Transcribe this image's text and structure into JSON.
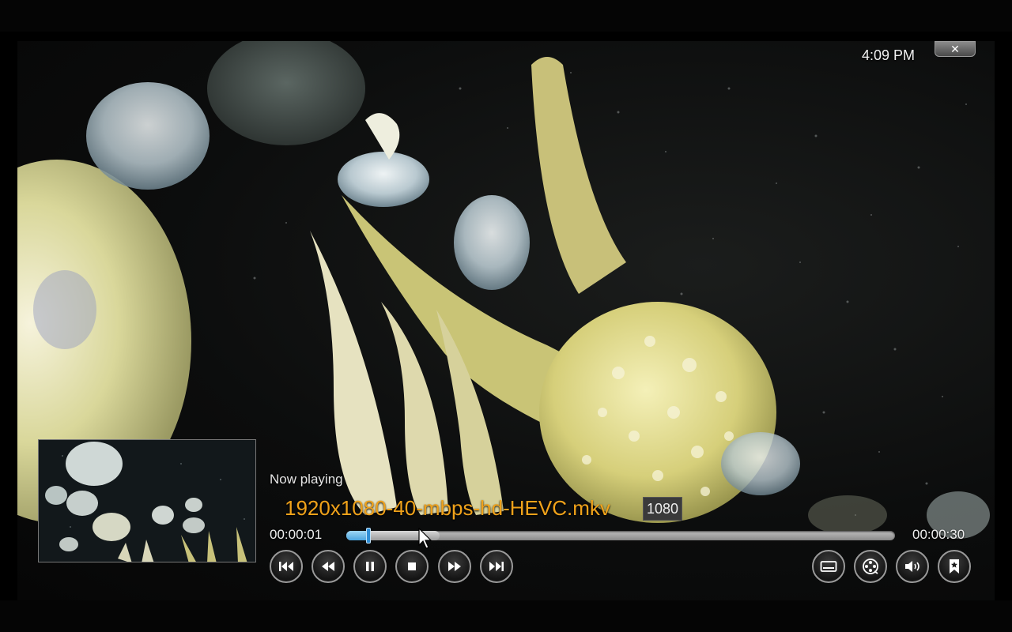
{
  "window": {
    "clock": "4:09 PM",
    "close_label": "✕"
  },
  "player": {
    "now_playing_label": "Now playing",
    "title": "1920x1080-40-mbps-hd-HEVC.mkv",
    "resolution_badge": "1080",
    "time_current": "00:00:01",
    "time_total": "00:00:30",
    "progress_fraction": 0.04,
    "buffer_fraction": 0.17
  },
  "controls": {
    "left": [
      {
        "name": "skip-previous-button",
        "icon": "skip-previous-icon"
      },
      {
        "name": "rewind-button",
        "icon": "rewind-icon"
      },
      {
        "name": "pause-button",
        "icon": "pause-icon"
      },
      {
        "name": "stop-button",
        "icon": "stop-icon"
      },
      {
        "name": "fast-forward-button",
        "icon": "fast-forward-icon"
      },
      {
        "name": "skip-next-button",
        "icon": "skip-next-icon"
      }
    ],
    "right": [
      {
        "name": "subtitles-button",
        "icon": "subtitles-icon"
      },
      {
        "name": "video-settings-button",
        "icon": "film-reel-icon"
      },
      {
        "name": "audio-settings-button",
        "icon": "volume-icon"
      },
      {
        "name": "bookmark-button",
        "icon": "bookmark-icon"
      }
    ]
  },
  "colors": {
    "title": "#f0a21a",
    "progress": "#4aa5de"
  }
}
